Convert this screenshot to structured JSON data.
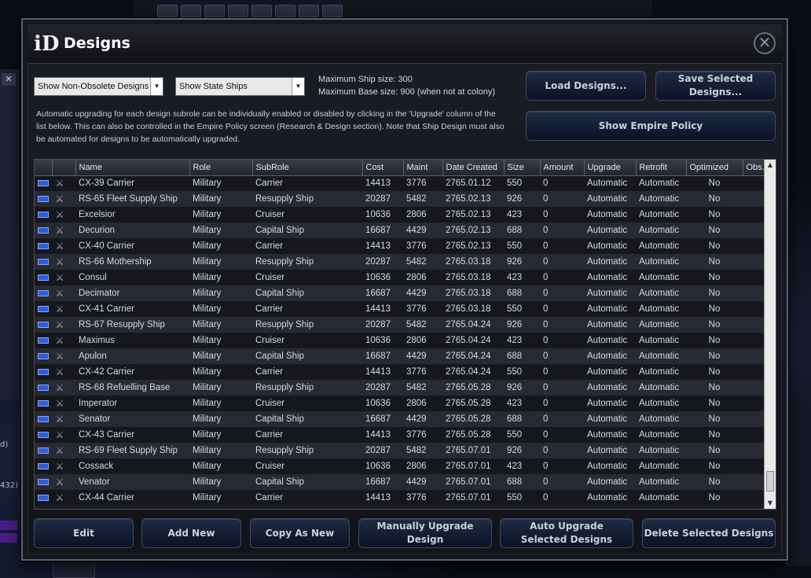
{
  "dialog": {
    "title": "Designs",
    "close_icon": "close-icon"
  },
  "filters": {
    "obsolete": "Show Non-Obsolete Designs",
    "ships": "Show State Ships"
  },
  "info": {
    "max_ship": "Maximum Ship size: 300",
    "max_base": "Maximum Base size: 900 (when not at colony)"
  },
  "buttons": {
    "load": "Load Designs...",
    "save": "Save Selected Designs...",
    "policy": "Show Empire Policy",
    "edit": "Edit",
    "add_new": "Add New",
    "copy_as_new": "Copy As New",
    "manual_upgrade": "Manually Upgrade Design",
    "auto_upgrade": "Auto Upgrade Selected Designs",
    "delete": "Delete Selected Designs"
  },
  "description": "Automatic upgrading for each design subrole can be individually enabled or disabled by clicking in the 'Upgrade' column of the list below. This can also be controlled in the Empire Policy screen (Research & Design section). Note that Ship Design must also be automated for designs to be automatically upgraded.",
  "table": {
    "columns": [
      "",
      "",
      "Name",
      "Role",
      "SubRole",
      "Cost",
      "Maint",
      "Date Created",
      "Size",
      "Amount",
      "Upgrade",
      "Retrofit",
      "Optimized",
      "Obs..."
    ],
    "rows": [
      [
        "CX-39 Carrier",
        "Military",
        "Carrier",
        "14413",
        "3776",
        "2765.01.12",
        "550",
        "0",
        "Automatic",
        "Automatic",
        "No"
      ],
      [
        "RS-65 Fleet Supply Ship",
        "Military",
        "Resupply Ship",
        "20287",
        "5482",
        "2765.02.13",
        "926",
        "0",
        "Automatic",
        "Automatic",
        "No"
      ],
      [
        "Excelsior",
        "Military",
        "Cruiser",
        "10636",
        "2806",
        "2765.02.13",
        "423",
        "0",
        "Automatic",
        "Automatic",
        "No"
      ],
      [
        "Decurion",
        "Military",
        "Capital Ship",
        "16687",
        "4429",
        "2765.02.13",
        "688",
        "0",
        "Automatic",
        "Automatic",
        "No"
      ],
      [
        "CX-40 Carrier",
        "Military",
        "Carrier",
        "14413",
        "3776",
        "2765.02.13",
        "550",
        "0",
        "Automatic",
        "Automatic",
        "No"
      ],
      [
        "RS-66 Mothership",
        "Military",
        "Resupply Ship",
        "20287",
        "5482",
        "2765.03.18",
        "926",
        "0",
        "Automatic",
        "Automatic",
        "No"
      ],
      [
        "Consul",
        "Military",
        "Cruiser",
        "10636",
        "2806",
        "2765.03.18",
        "423",
        "0",
        "Automatic",
        "Automatic",
        "No"
      ],
      [
        "Decimator",
        "Military",
        "Capital Ship",
        "16687",
        "4429",
        "2765.03.18",
        "688",
        "0",
        "Automatic",
        "Automatic",
        "No"
      ],
      [
        "CX-41 Carrier",
        "Military",
        "Carrier",
        "14413",
        "3776",
        "2765.03.18",
        "550",
        "0",
        "Automatic",
        "Automatic",
        "No"
      ],
      [
        "RS-67 Resupply Ship",
        "Military",
        "Resupply Ship",
        "20287",
        "5482",
        "2765.04.24",
        "926",
        "0",
        "Automatic",
        "Automatic",
        "No"
      ],
      [
        "Maximus",
        "Military",
        "Cruiser",
        "10636",
        "2806",
        "2765.04.24",
        "423",
        "0",
        "Automatic",
        "Automatic",
        "No"
      ],
      [
        "Apulon",
        "Military",
        "Capital Ship",
        "16687",
        "4429",
        "2765.04.24",
        "688",
        "0",
        "Automatic",
        "Automatic",
        "No"
      ],
      [
        "CX-42 Carrier",
        "Military",
        "Carrier",
        "14413",
        "3776",
        "2765.04.24",
        "550",
        "0",
        "Automatic",
        "Automatic",
        "No"
      ],
      [
        "RS-68 Refuelling Base",
        "Military",
        "Resupply Ship",
        "20287",
        "5482",
        "2765.05.28",
        "926",
        "0",
        "Automatic",
        "Automatic",
        "No"
      ],
      [
        "Imperator",
        "Military",
        "Cruiser",
        "10636",
        "2806",
        "2765.05.28",
        "423",
        "0",
        "Automatic",
        "Automatic",
        "No"
      ],
      [
        "Senator",
        "Military",
        "Capital Ship",
        "16687",
        "4429",
        "2765.05.28",
        "688",
        "0",
        "Automatic",
        "Automatic",
        "No"
      ],
      [
        "CX-43 Carrier",
        "Military",
        "Carrier",
        "14413",
        "3776",
        "2765.05.28",
        "550",
        "0",
        "Automatic",
        "Automatic",
        "No"
      ],
      [
        "RS-69 Fleet Supply Ship",
        "Military",
        "Resupply Ship",
        "20287",
        "5482",
        "2765.07.01",
        "926",
        "0",
        "Automatic",
        "Automatic",
        "No"
      ],
      [
        "Cossack",
        "Military",
        "Cruiser",
        "10636",
        "2806",
        "2765.07.01",
        "423",
        "0",
        "Automatic",
        "Automatic",
        "No"
      ],
      [
        "Venator",
        "Military",
        "Capital Ship",
        "16687",
        "4429",
        "2765.07.01",
        "688",
        "0",
        "Automatic",
        "Automatic",
        "No"
      ],
      [
        "CX-44 Carrier",
        "Military",
        "Carrier",
        "14413",
        "3776",
        "2765.07.01",
        "550",
        "0",
        "Automatic",
        "Automatic",
        "No"
      ]
    ]
  },
  "background": {
    "left_text_1": "d)",
    "left_text_2": "432)"
  },
  "colors": {
    "flag": "#2e5cd6",
    "button_top": "#1f2a44",
    "button_bottom": "#0b1224"
  }
}
